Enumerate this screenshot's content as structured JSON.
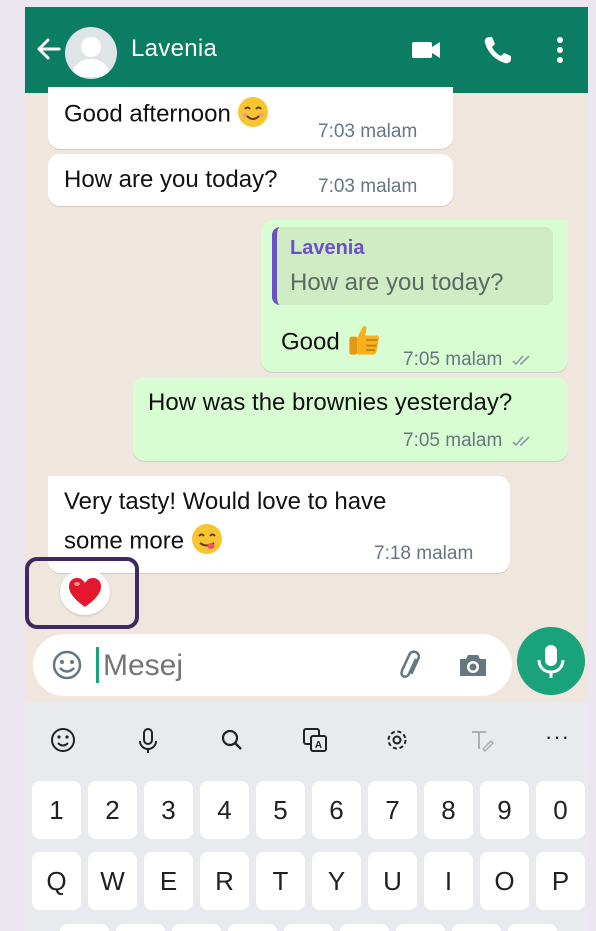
{
  "header": {
    "contact_name": "Lavenia",
    "back_icon": "arrow-left-icon",
    "avatar_icon": "default-avatar-icon",
    "video_icon": "video-camera-icon",
    "call_icon": "phone-icon",
    "menu_icon": "more-vertical-icon"
  },
  "messages": [
    {
      "direction": "in",
      "text": "Good afternoon",
      "emoji": "smiling-face-icon",
      "time": "7:03 malam"
    },
    {
      "direction": "in",
      "text": "How are you today?",
      "time": "7:03 malam"
    },
    {
      "direction": "out",
      "reply_to_name": "Lavenia",
      "reply_to_text": "How are you today?",
      "text": "Good",
      "emoji": "thumbs-up-icon",
      "time": "7:05 malam",
      "status": "read"
    },
    {
      "direction": "out",
      "text": "How was the brownies yesterday?",
      "time": "7:05 malam",
      "status": "read"
    },
    {
      "direction": "in",
      "text_line1": "Very tasty! Would love to have",
      "text_line2": "some more",
      "emoji": "yum-face-icon",
      "time": "7:18 malam",
      "reaction": "red-heart-icon"
    }
  ],
  "composer": {
    "placeholder": "Mesej",
    "emoji_icon": "emoji-icon",
    "attach_icon": "paperclip-icon",
    "camera_icon": "camera-icon",
    "mic_icon": "microphone-icon"
  },
  "keyboard": {
    "toolbar": [
      "emoji-icon",
      "microphone-icon",
      "search-icon",
      "translate-icon",
      "settings-icon",
      "handwriting-icon",
      "more-icon"
    ],
    "toolbar_more": "···",
    "row_numbers": [
      "1",
      "2",
      "3",
      "4",
      "5",
      "6",
      "7",
      "8",
      "9",
      "0"
    ],
    "row_letters": [
      "Q",
      "W",
      "E",
      "R",
      "T",
      "Y",
      "U",
      "I",
      "O",
      "P"
    ]
  },
  "colors": {
    "header": "#0a7d62",
    "chat_background": "#efe7de",
    "outgoing_bubble": "#d9fdd3",
    "incoming_bubble": "#ffffff",
    "reply_accent": "#6b50c8",
    "mic_button": "#1aa37a",
    "highlight_box": "#3d2a63"
  }
}
